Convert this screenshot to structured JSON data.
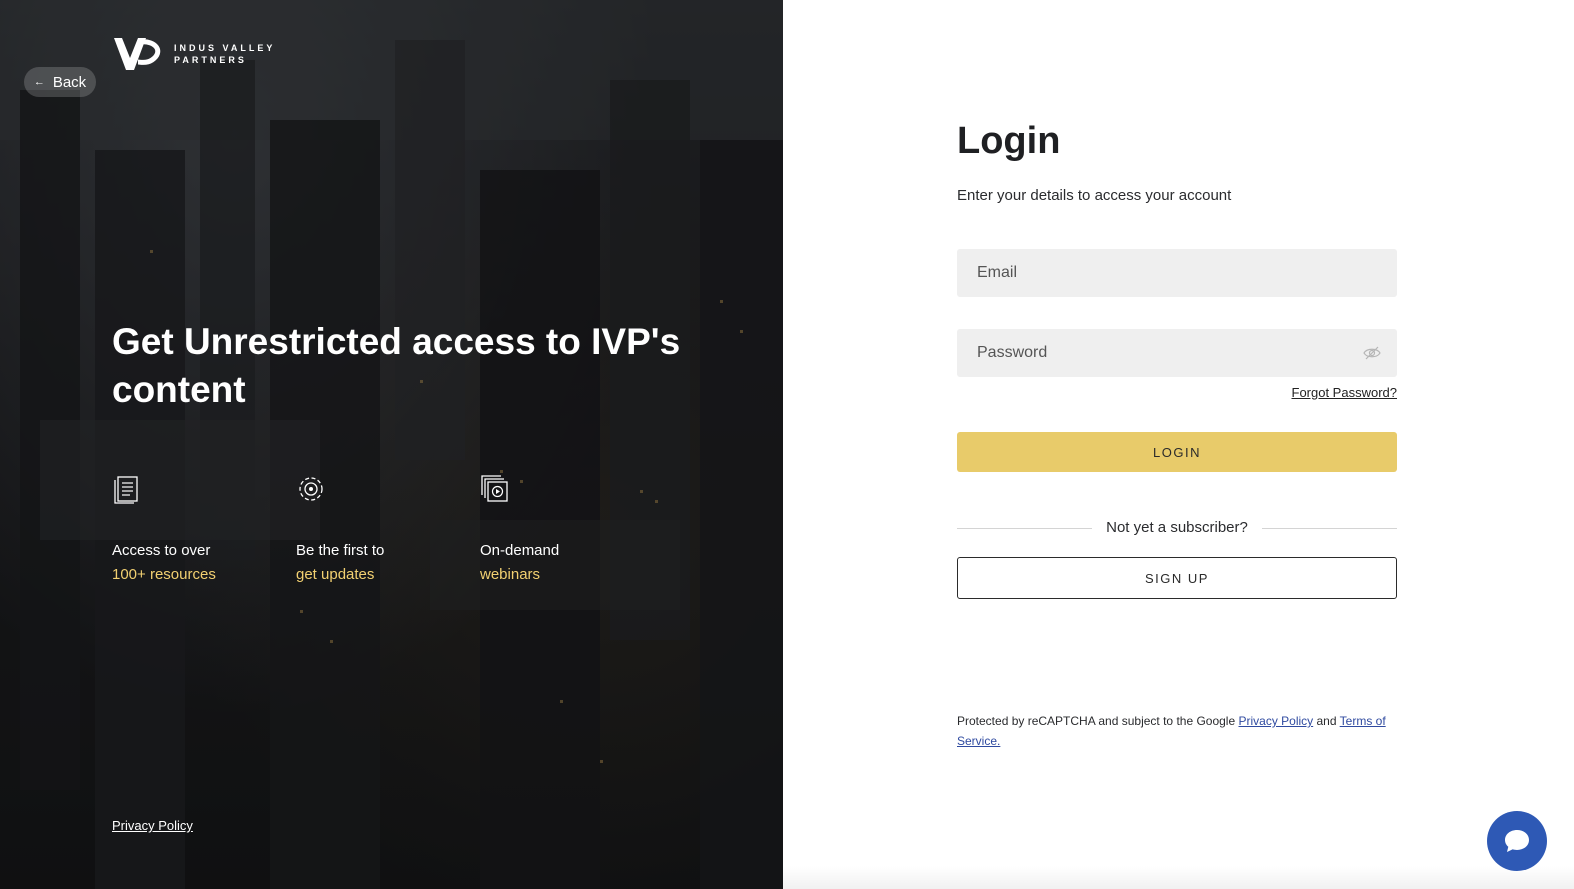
{
  "brand": {
    "line1": "INDUS VALLEY",
    "line2": "PARTNERS"
  },
  "nav": {
    "back_label": "Back"
  },
  "hero": {
    "headline": "Get Unrestricted access to IVP's content",
    "features": [
      {
        "icon": "document-icon",
        "line1": "Access to over",
        "line2": "100+ resources"
      },
      {
        "icon": "gear-icon",
        "line1": "Be the first to",
        "line2": "get updates"
      },
      {
        "icon": "video-icon",
        "line1": "On-demand",
        "line2": "webinars"
      }
    ],
    "privacy_label": "Privacy Policy"
  },
  "form": {
    "title": "Login",
    "subtitle": "Enter your details to access your account",
    "email_placeholder": "Email",
    "password_placeholder": "Password",
    "forgot_label": "Forgot Password?",
    "login_label": "LOGIN",
    "divider_text": "Not yet a subscriber?",
    "signup_label": "SIGN UP"
  },
  "recaptcha": {
    "prefix": "Protected by reCAPTCHA and subject to the Google ",
    "privacy_link": "Privacy Policy",
    "middle": " and ",
    "terms_link": "Terms of Service."
  },
  "colors": {
    "accent": "#e8cb6a",
    "highlight": "#f2d071",
    "chat": "#2e59b5"
  }
}
